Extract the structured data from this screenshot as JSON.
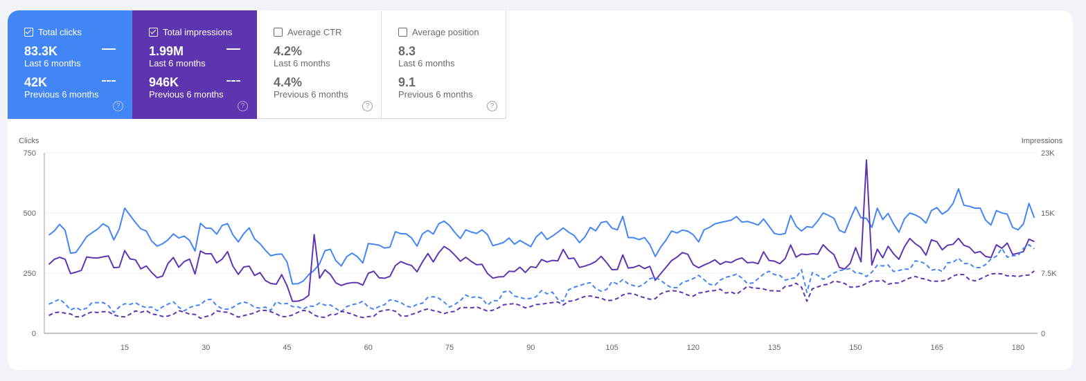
{
  "metrics": [
    {
      "id": "clicks",
      "label": "Total clicks",
      "checked": true,
      "current": "83.3K",
      "current_label": "Last 6 months",
      "previous": "42K",
      "previous_label": "Previous 6 months",
      "color": "#4285f4"
    },
    {
      "id": "impressions",
      "label": "Total impressions",
      "checked": true,
      "current": "1.99M",
      "current_label": "Last 6 months",
      "previous": "946K",
      "previous_label": "Previous 6 months",
      "color": "#5e35b1"
    },
    {
      "id": "ctr",
      "label": "Average CTR",
      "checked": false,
      "current": "4.2%",
      "current_label": "Last 6 months",
      "previous": "4.4%",
      "previous_label": "Previous 6 months"
    },
    {
      "id": "position",
      "label": "Average position",
      "checked": false,
      "current": "8.3",
      "current_label": "Last 6 months",
      "previous": "9.1",
      "previous_label": "Previous 6 months"
    }
  ],
  "help_glyph": "?",
  "chart_data": {
    "type": "line",
    "ylabel": "Clicks",
    "y2label": "Impressions",
    "ylim": [
      0,
      750
    ],
    "y2lim": [
      0,
      22500
    ],
    "yticks": [
      "0",
      "250",
      "500",
      "750"
    ],
    "yticks_values": [
      0,
      250,
      500,
      750
    ],
    "y2ticks": [
      "0",
      "7.5K",
      "15K",
      "23K"
    ],
    "xticks": [
      15,
      30,
      45,
      60,
      75,
      90,
      105,
      120,
      135,
      150,
      165,
      180
    ],
    "xlim": [
      1,
      184
    ],
    "grid": true,
    "series": [
      {
        "name": "Clicks (Last 6 months)",
        "axis": "left",
        "color": "#4285f4",
        "dash": false,
        "values": [
          408,
          425,
          453,
          428,
          333,
          336,
          368,
          402,
          418,
          433,
          455,
          442,
          388,
          433,
          520,
          490,
          460,
          434,
          425,
          383,
          362,
          372,
          388,
          413,
          396,
          404,
          386,
          342,
          457,
          437,
          436,
          412,
          448,
          456,
          409,
          380,
          414,
          438,
          392,
          372,
          345,
          322,
          328,
          330,
          296,
          205,
          206,
          217,
          244,
          262,
          289,
          343,
          349,
          302,
          280,
          318,
          333,
          318,
          292,
          373,
          370,
          366,
          354,
          358,
          422,
          414,
          413,
          396,
          362,
          413,
          428,
          412,
          455,
          466,
          448,
          418,
          394,
          430,
          421,
          415,
          430,
          410,
          364,
          370,
          378,
          396,
          370,
          386,
          373,
          360,
          400,
          420,
          390,
          404,
          420,
          438,
          420,
          407,
          377,
          400,
          440,
          426,
          460,
          465,
          437,
          430,
          486,
          398,
          397,
          389,
          398,
          369,
          319,
          358,
          388,
          425,
          417,
          429,
          424,
          410,
          380,
          430,
          440,
          455,
          460,
          465,
          470,
          485,
          462,
          465,
          458,
          450,
          475,
          445,
          415,
          410,
          415,
          490,
          445,
          425,
          443,
          440,
          467,
          500,
          490,
          478,
          428,
          418,
          475,
          525,
          480,
          478,
          440,
          520,
          473,
          498,
          455,
          420,
          475,
          500,
          492,
          480,
          458,
          510,
          522,
          495,
          510,
          540,
          600,
          532,
          528,
          520,
          520,
          470,
          450,
          510,
          500,
          495,
          440,
          430,
          455,
          540,
          480
        ],
        "__note": "values filled below by script"
      },
      {
        "name": "Impressions (Last 6 months)",
        "axis": "right",
        "color": "#5e35b1",
        "dash": false,
        "values": []
      },
      {
        "name": "Clicks (Previous 6 months)",
        "axis": "left",
        "color": "#4285f4",
        "dash": true,
        "values": []
      },
      {
        "name": "Impressions (Previous 6 months)",
        "axis": "right",
        "color": "#5e35b1",
        "dash": true,
        "values": []
      }
    ]
  }
}
